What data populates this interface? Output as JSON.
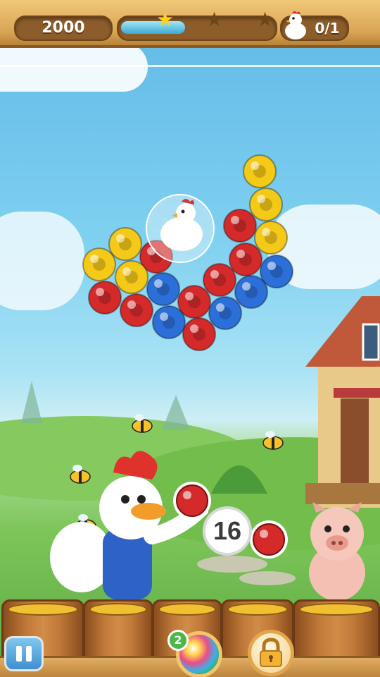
{
  "hud": {
    "score": "2000",
    "progress_fraction": 0.42,
    "stars_earned": 1,
    "stars_total": 3,
    "goal_text": "0/1",
    "goal_icon": "hen-icon"
  },
  "game": {
    "shots_left": "16",
    "current_bubble_color": "red",
    "next_bubble_color": "red",
    "booster_count": "2"
  },
  "colors": {
    "red": "#d42a2a",
    "yellow": "#f5c918",
    "blue": "#2c6fd8",
    "star_gold": "#ffd21f",
    "star_empty": "#6e4419"
  },
  "icons": [
    "pause-icon",
    "lock-icon",
    "rainbow-booster-icon",
    "star-icon",
    "hen-icon",
    "rooster-icon",
    "pig-icon",
    "bee-icon"
  ]
}
